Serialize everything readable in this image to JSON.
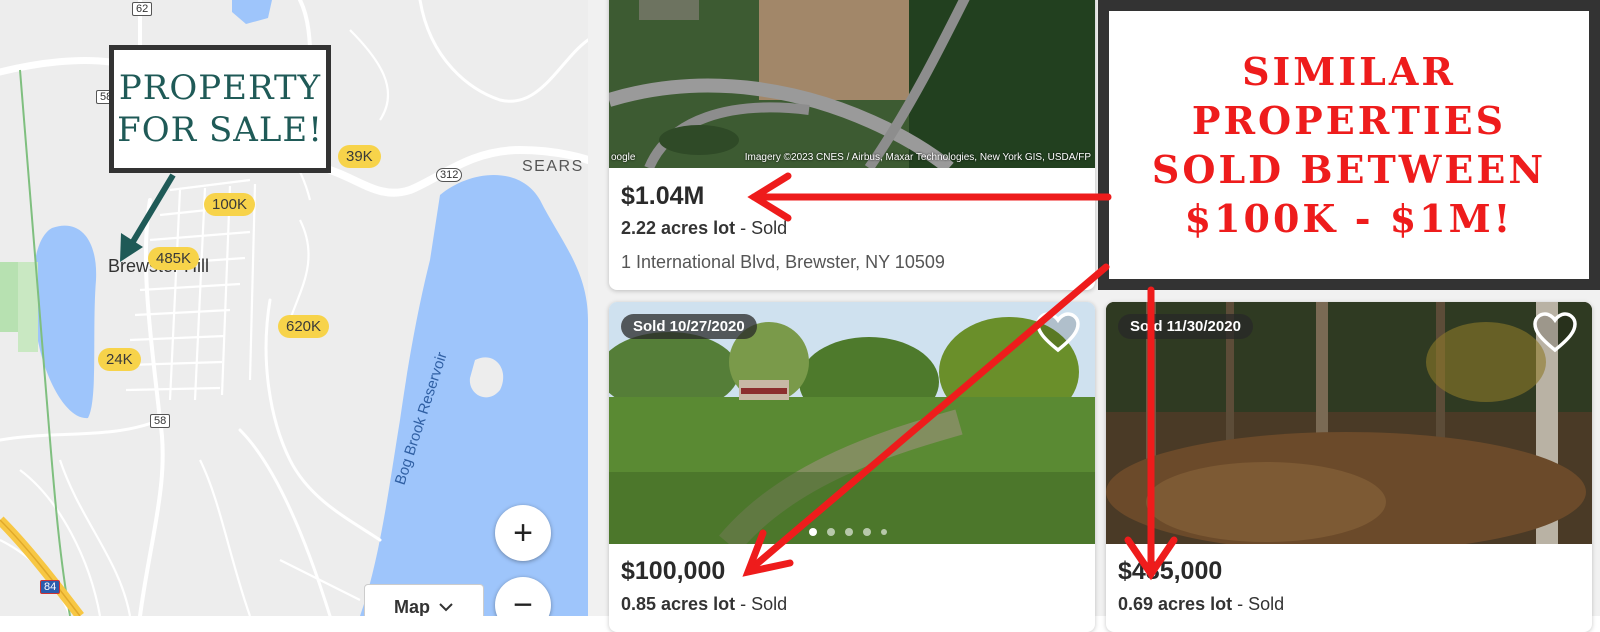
{
  "map": {
    "route_labels": [
      "62",
      "58",
      "312",
      "58",
      "84"
    ],
    "place_labels": {
      "brewster_hill": "Brewster Hill",
      "sears": "SEARS",
      "reservoir": "Bog Brook Reservoir"
    },
    "price_pills": [
      "39K",
      "100K",
      "485K",
      "620K",
      "24K"
    ],
    "zoom_in": "+",
    "zoom_out": "−",
    "map_type_button": "Map",
    "colors": {
      "land": "#ededed",
      "water": "#9ec5fb",
      "road": "#ffffff",
      "highway": "#f7c744",
      "park": "#b7e1b1",
      "pill": "#f7d34a"
    }
  },
  "callouts": {
    "property": {
      "line1": "PROPERTY",
      "line2": "FOR SALE!"
    },
    "similar": {
      "line1": "SIMILAR",
      "line2": "PROPERTIES",
      "line3": "SOLD BETWEEN",
      "line4": "$100K - $1M!"
    }
  },
  "listings": [
    {
      "price": "$1.04M",
      "lot_size": "2.22 acres lot",
      "status": " - Sold",
      "address": "1 International Blvd, Brewster, NY 10509",
      "photo_credit": "Imagery ©2023 CNES / Airbus, Maxar Technologies, New York GIS, USDA/FP",
      "photo_brand": "oogle"
    },
    {
      "sold_badge": "Sold 10/27/2020",
      "price": "$100,000",
      "lot_size": "0.85 acres lot",
      "status": " - Sold",
      "carousel_dots": 5,
      "carousel_active": 1
    },
    {
      "sold_badge": "Sold 11/30/2020",
      "price": "$485,000",
      "lot_size": "0.69 acres lot",
      "status": " - Sold"
    }
  ],
  "annotation_color": "#ee1c1c"
}
